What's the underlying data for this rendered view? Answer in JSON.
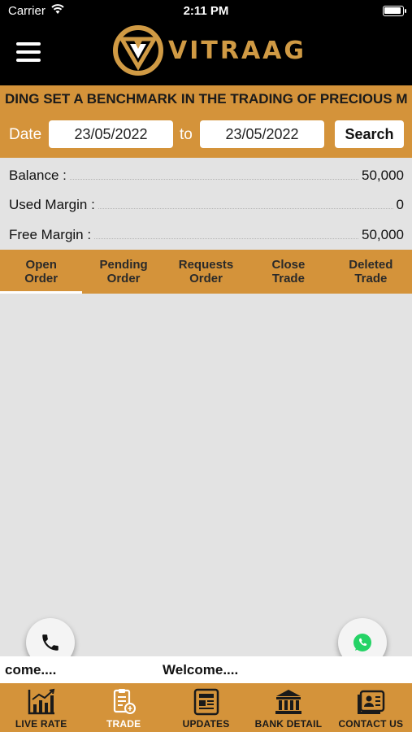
{
  "status_bar": {
    "carrier": "Carrier",
    "time": "2:11 PM"
  },
  "header": {
    "brand": "VITRAAG"
  },
  "ticker": {
    "text": "DING SET A BENCHMARK IN THE TRADING OF PRECIOUS M"
  },
  "filter": {
    "date_label": "Date",
    "from_date": "23/05/2022",
    "to_label": "to",
    "to_date": "23/05/2022",
    "search_label": "Search"
  },
  "summary": {
    "rows": [
      {
        "label": "Balance :",
        "value": "50,000"
      },
      {
        "label": "Used Margin :",
        "value": "0"
      },
      {
        "label": "Free Margin :",
        "value": "50,000"
      }
    ]
  },
  "tabs": [
    {
      "line1": "Open",
      "line2": "Order",
      "active": true
    },
    {
      "line1": "Pending",
      "line2": "Order",
      "active": false
    },
    {
      "line1": "Requests",
      "line2": "Order",
      "active": false
    },
    {
      "line1": "Close",
      "line2": "Trade",
      "active": false
    },
    {
      "line1": "Deleted",
      "line2": "Trade",
      "active": false
    }
  ],
  "marquee": {
    "left_text": "come....",
    "center_text": "Welcome...."
  },
  "bottom_nav": [
    {
      "label": "LIVE RATE",
      "icon": "chart-icon"
    },
    {
      "label": "TRADE",
      "icon": "trade-icon"
    },
    {
      "label": "UPDATES",
      "icon": "newspaper-icon"
    },
    {
      "label": "BANK DETAIL",
      "icon": "bank-icon"
    },
    {
      "label": "CONTACT US",
      "icon": "contact-card-icon"
    }
  ],
  "colors": {
    "accent": "#d4933a",
    "brand_gold": "#d09a44",
    "header_bg": "#000000",
    "whatsapp": "#25d366"
  }
}
